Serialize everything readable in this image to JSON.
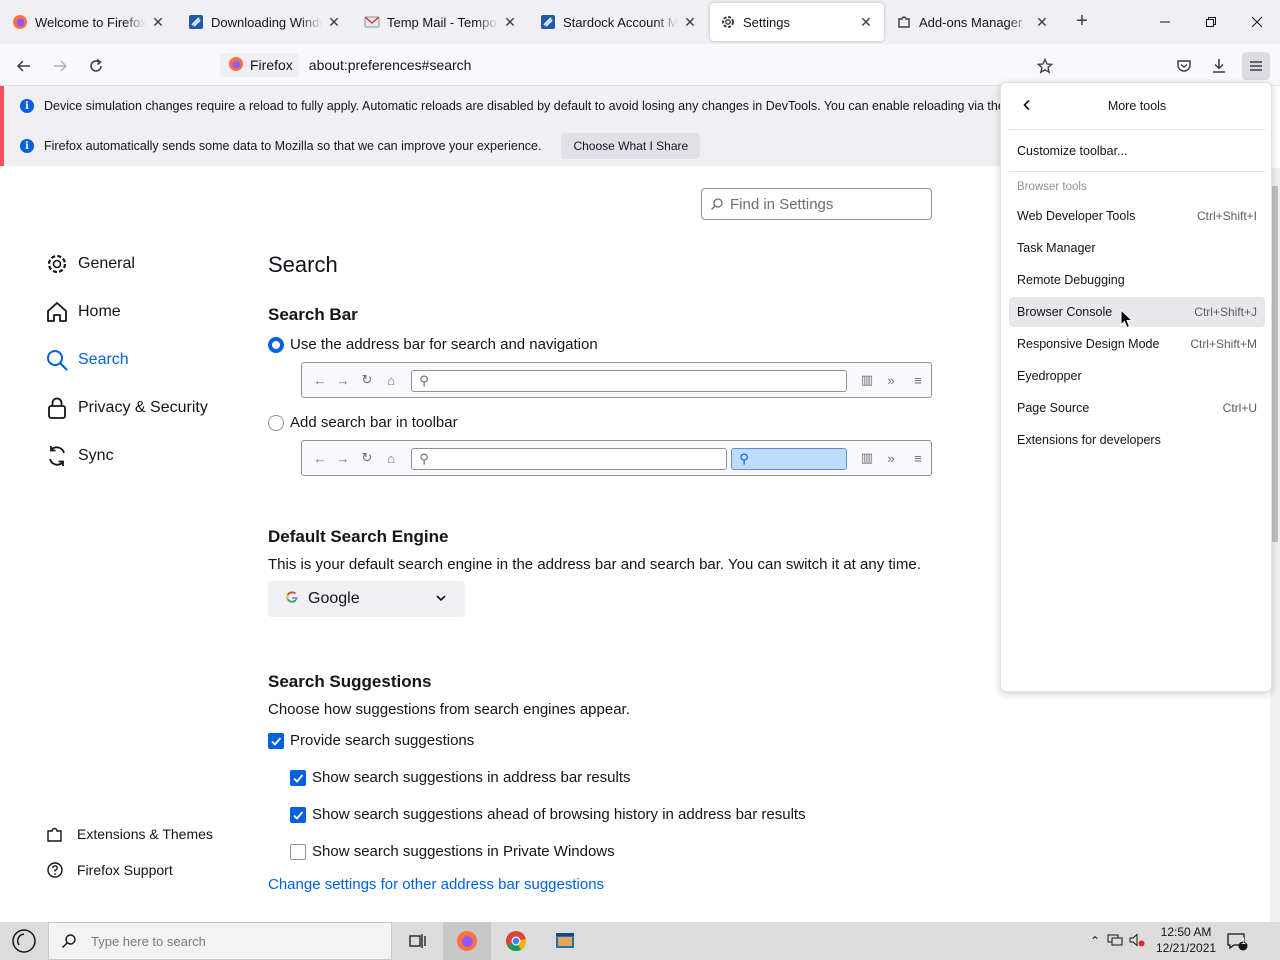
{
  "tabs": [
    {
      "title": "Welcome to Firefox",
      "icon": "firefox-icon"
    },
    {
      "title": "Downloading Windows",
      "icon": "stardock-icon"
    },
    {
      "title": "Temp Mail - Temporary",
      "icon": "mail-icon"
    },
    {
      "title": "Stardock Account Manager",
      "icon": "stardock-icon"
    },
    {
      "title": "Settings",
      "icon": "gear-icon",
      "selected": true
    },
    {
      "title": "Add-ons Manager",
      "icon": "puzzle-icon"
    }
  ],
  "urlbar": {
    "identity": "Firefox",
    "url": "about:preferences#search"
  },
  "notifications": [
    {
      "text": "Device simulation changes require a reload to fully apply. Automatic reloads are disabled by default to avoid losing any changes in DevTools. You can enable reloading via the Settings menu."
    },
    {
      "text": "Firefox automatically sends some data to Mozilla so that we can improve your experience.",
      "button": "Choose What I Share"
    }
  ],
  "find_placeholder": "Find in Settings",
  "sidebar": {
    "items": [
      {
        "label": "General",
        "icon": "gear-icon"
      },
      {
        "label": "Home",
        "icon": "home-icon"
      },
      {
        "label": "Search",
        "icon": "search-icon",
        "active": true
      },
      {
        "label": "Privacy & Security",
        "icon": "lock-icon"
      },
      {
        "label": "Sync",
        "icon": "sync-icon"
      }
    ],
    "footer": [
      {
        "label": "Extensions & Themes",
        "icon": "puzzle-icon"
      },
      {
        "label": "Firefox Support",
        "icon": "help-icon"
      }
    ]
  },
  "main": {
    "title": "Search",
    "search_bar": {
      "heading": "Search Bar",
      "option_address": "Use the address bar for search and navigation",
      "option_toolbar": "Add search bar in toolbar",
      "selected": "address"
    },
    "default_engine": {
      "heading": "Default Search Engine",
      "description": "This is your default search engine in the address bar and search bar. You can switch it at any time.",
      "selected": "Google"
    },
    "suggestions": {
      "heading": "Search Suggestions",
      "description": "Choose how suggestions from search engines appear.",
      "provide": {
        "label": "Provide search suggestions",
        "checked": true
      },
      "in_address_bar": {
        "label": "Show search suggestions in address bar results",
        "checked": true
      },
      "ahead_of_history": {
        "label": "Show search suggestions ahead of browsing history in address bar results",
        "checked": true
      },
      "private_windows": {
        "label": "Show search suggestions in Private Windows",
        "checked": false
      },
      "link": "Change settings for other address bar suggestions"
    }
  },
  "menu_panel": {
    "title": "More tools",
    "customize": "Customize toolbar...",
    "section_label": "Browser tools",
    "items": [
      {
        "label": "Web Developer Tools",
        "shortcut": "Ctrl+Shift+I"
      },
      {
        "label": "Task Manager",
        "shortcut": ""
      },
      {
        "label": "Remote Debugging",
        "shortcut": ""
      },
      {
        "label": "Browser Console",
        "shortcut": "Ctrl+Shift+J",
        "hovered": true
      },
      {
        "label": "Responsive Design Mode",
        "shortcut": "Ctrl+Shift+M"
      },
      {
        "label": "Eyedropper",
        "shortcut": ""
      },
      {
        "label": "Page Source",
        "shortcut": "Ctrl+U"
      },
      {
        "label": "Extensions for developers",
        "shortcut": ""
      }
    ]
  },
  "taskbar": {
    "search_placeholder": "Type here to search",
    "time": "12:50 AM",
    "date": "12/21/2021",
    "notification_count": "1"
  },
  "colors": {
    "accent": "#0061e0",
    "notif_stripe": "#ff4f5e",
    "info_blue": "#0060df"
  }
}
